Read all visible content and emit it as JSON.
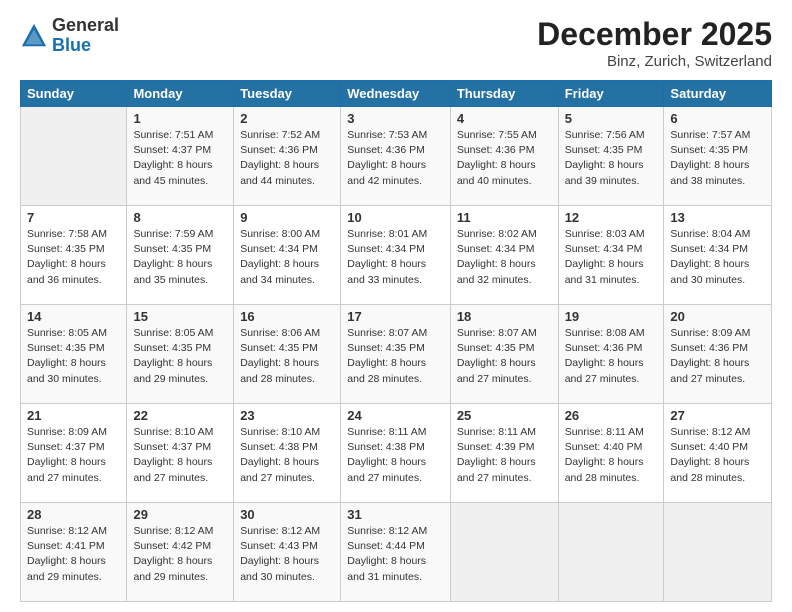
{
  "header": {
    "logo_general": "General",
    "logo_blue": "Blue",
    "title": "December 2025",
    "subtitle": "Binz, Zurich, Switzerland"
  },
  "columns": [
    "Sunday",
    "Monday",
    "Tuesday",
    "Wednesday",
    "Thursday",
    "Friday",
    "Saturday"
  ],
  "weeks": [
    [
      {
        "day": "",
        "sunrise": "",
        "sunset": "",
        "daylight": ""
      },
      {
        "day": "1",
        "sunrise": "Sunrise: 7:51 AM",
        "sunset": "Sunset: 4:37 PM",
        "daylight": "Daylight: 8 hours and 45 minutes."
      },
      {
        "day": "2",
        "sunrise": "Sunrise: 7:52 AM",
        "sunset": "Sunset: 4:36 PM",
        "daylight": "Daylight: 8 hours and 44 minutes."
      },
      {
        "day": "3",
        "sunrise": "Sunrise: 7:53 AM",
        "sunset": "Sunset: 4:36 PM",
        "daylight": "Daylight: 8 hours and 42 minutes."
      },
      {
        "day": "4",
        "sunrise": "Sunrise: 7:55 AM",
        "sunset": "Sunset: 4:36 PM",
        "daylight": "Daylight: 8 hours and 40 minutes."
      },
      {
        "day": "5",
        "sunrise": "Sunrise: 7:56 AM",
        "sunset": "Sunset: 4:35 PM",
        "daylight": "Daylight: 8 hours and 39 minutes."
      },
      {
        "day": "6",
        "sunrise": "Sunrise: 7:57 AM",
        "sunset": "Sunset: 4:35 PM",
        "daylight": "Daylight: 8 hours and 38 minutes."
      }
    ],
    [
      {
        "day": "7",
        "sunrise": "Sunrise: 7:58 AM",
        "sunset": "Sunset: 4:35 PM",
        "daylight": "Daylight: 8 hours and 36 minutes."
      },
      {
        "day": "8",
        "sunrise": "Sunrise: 7:59 AM",
        "sunset": "Sunset: 4:35 PM",
        "daylight": "Daylight: 8 hours and 35 minutes."
      },
      {
        "day": "9",
        "sunrise": "Sunrise: 8:00 AM",
        "sunset": "Sunset: 4:34 PM",
        "daylight": "Daylight: 8 hours and 34 minutes."
      },
      {
        "day": "10",
        "sunrise": "Sunrise: 8:01 AM",
        "sunset": "Sunset: 4:34 PM",
        "daylight": "Daylight: 8 hours and 33 minutes."
      },
      {
        "day": "11",
        "sunrise": "Sunrise: 8:02 AM",
        "sunset": "Sunset: 4:34 PM",
        "daylight": "Daylight: 8 hours and 32 minutes."
      },
      {
        "day": "12",
        "sunrise": "Sunrise: 8:03 AM",
        "sunset": "Sunset: 4:34 PM",
        "daylight": "Daylight: 8 hours and 31 minutes."
      },
      {
        "day": "13",
        "sunrise": "Sunrise: 8:04 AM",
        "sunset": "Sunset: 4:34 PM",
        "daylight": "Daylight: 8 hours and 30 minutes."
      }
    ],
    [
      {
        "day": "14",
        "sunrise": "Sunrise: 8:05 AM",
        "sunset": "Sunset: 4:35 PM",
        "daylight": "Daylight: 8 hours and 30 minutes."
      },
      {
        "day": "15",
        "sunrise": "Sunrise: 8:05 AM",
        "sunset": "Sunset: 4:35 PM",
        "daylight": "Daylight: 8 hours and 29 minutes."
      },
      {
        "day": "16",
        "sunrise": "Sunrise: 8:06 AM",
        "sunset": "Sunset: 4:35 PM",
        "daylight": "Daylight: 8 hours and 28 minutes."
      },
      {
        "day": "17",
        "sunrise": "Sunrise: 8:07 AM",
        "sunset": "Sunset: 4:35 PM",
        "daylight": "Daylight: 8 hours and 28 minutes."
      },
      {
        "day": "18",
        "sunrise": "Sunrise: 8:07 AM",
        "sunset": "Sunset: 4:35 PM",
        "daylight": "Daylight: 8 hours and 27 minutes."
      },
      {
        "day": "19",
        "sunrise": "Sunrise: 8:08 AM",
        "sunset": "Sunset: 4:36 PM",
        "daylight": "Daylight: 8 hours and 27 minutes."
      },
      {
        "day": "20",
        "sunrise": "Sunrise: 8:09 AM",
        "sunset": "Sunset: 4:36 PM",
        "daylight": "Daylight: 8 hours and 27 minutes."
      }
    ],
    [
      {
        "day": "21",
        "sunrise": "Sunrise: 8:09 AM",
        "sunset": "Sunset: 4:37 PM",
        "daylight": "Daylight: 8 hours and 27 minutes."
      },
      {
        "day": "22",
        "sunrise": "Sunrise: 8:10 AM",
        "sunset": "Sunset: 4:37 PM",
        "daylight": "Daylight: 8 hours and 27 minutes."
      },
      {
        "day": "23",
        "sunrise": "Sunrise: 8:10 AM",
        "sunset": "Sunset: 4:38 PM",
        "daylight": "Daylight: 8 hours and 27 minutes."
      },
      {
        "day": "24",
        "sunrise": "Sunrise: 8:11 AM",
        "sunset": "Sunset: 4:38 PM",
        "daylight": "Daylight: 8 hours and 27 minutes."
      },
      {
        "day": "25",
        "sunrise": "Sunrise: 8:11 AM",
        "sunset": "Sunset: 4:39 PM",
        "daylight": "Daylight: 8 hours and 27 minutes."
      },
      {
        "day": "26",
        "sunrise": "Sunrise: 8:11 AM",
        "sunset": "Sunset: 4:40 PM",
        "daylight": "Daylight: 8 hours and 28 minutes."
      },
      {
        "day": "27",
        "sunrise": "Sunrise: 8:12 AM",
        "sunset": "Sunset: 4:40 PM",
        "daylight": "Daylight: 8 hours and 28 minutes."
      }
    ],
    [
      {
        "day": "28",
        "sunrise": "Sunrise: 8:12 AM",
        "sunset": "Sunset: 4:41 PM",
        "daylight": "Daylight: 8 hours and 29 minutes."
      },
      {
        "day": "29",
        "sunrise": "Sunrise: 8:12 AM",
        "sunset": "Sunset: 4:42 PM",
        "daylight": "Daylight: 8 hours and 29 minutes."
      },
      {
        "day": "30",
        "sunrise": "Sunrise: 8:12 AM",
        "sunset": "Sunset: 4:43 PM",
        "daylight": "Daylight: 8 hours and 30 minutes."
      },
      {
        "day": "31",
        "sunrise": "Sunrise: 8:12 AM",
        "sunset": "Sunset: 4:44 PM",
        "daylight": "Daylight: 8 hours and 31 minutes."
      },
      {
        "day": "",
        "sunrise": "",
        "sunset": "",
        "daylight": ""
      },
      {
        "day": "",
        "sunrise": "",
        "sunset": "",
        "daylight": ""
      },
      {
        "day": "",
        "sunrise": "",
        "sunset": "",
        "daylight": ""
      }
    ]
  ]
}
